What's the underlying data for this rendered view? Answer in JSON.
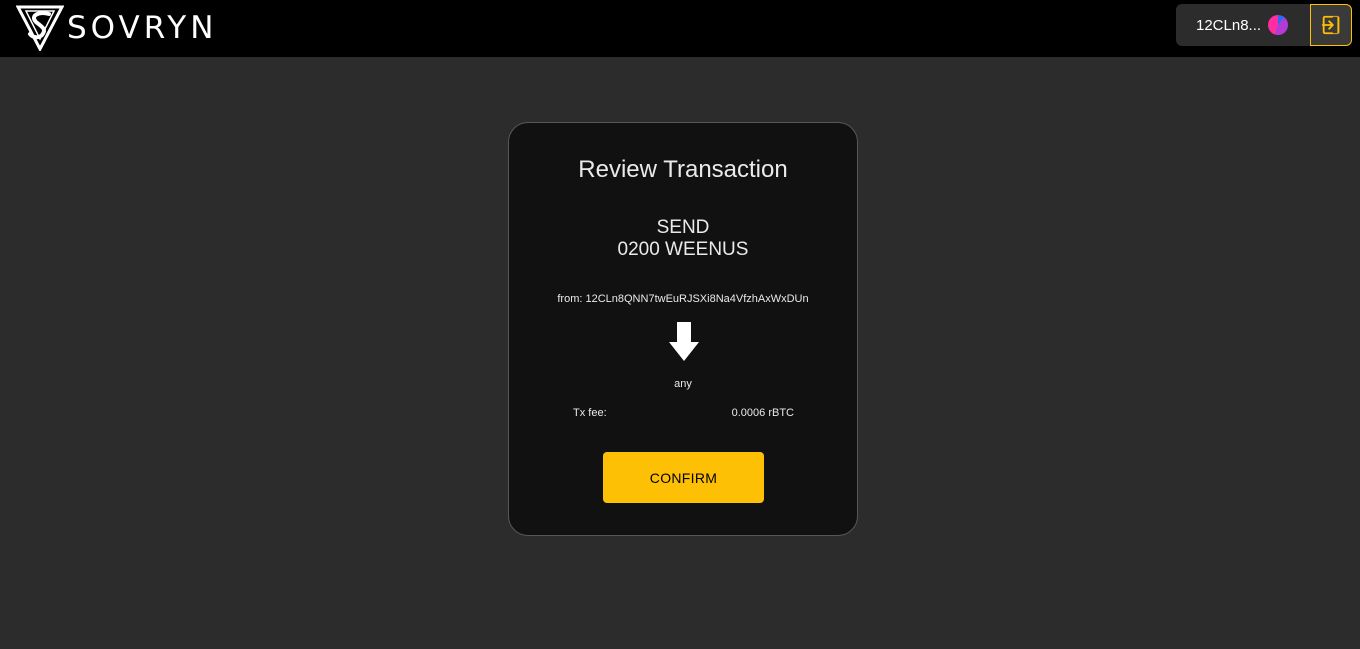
{
  "header": {
    "brand": "SOVRYN",
    "logo_icon": "sovryn-logo-icon",
    "wallet_address_short": "12CLn8...",
    "avatar_icon": "wallet-avatar-icon",
    "logout_icon": "logout-icon"
  },
  "review": {
    "title": "Review Transaction",
    "action": "SEND",
    "amount": "0200 WEENUS",
    "from": "from: 12CLn8QNN7twEuRJSXi8Na4VfzhAxWxDUn",
    "arrow_icon": "arrow-down-icon",
    "to": "any",
    "fee_label": "Tx fee:",
    "fee_value": "0.0006 rBTC",
    "confirm_label": "CONFIRM"
  },
  "colors": {
    "page_bg": "#2c2c2c",
    "topbar_bg": "#000000",
    "card_bg": "#111111",
    "accent": "#fec004",
    "text": "#e9eae9"
  }
}
